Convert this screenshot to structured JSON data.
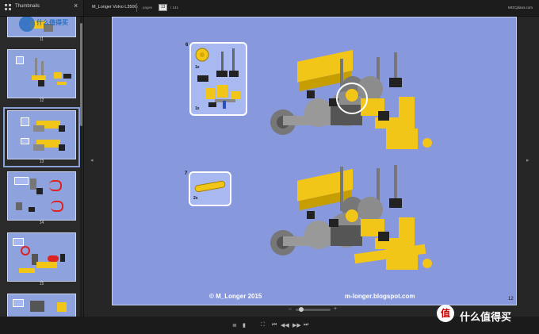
{
  "app": {
    "panel_title": "Thumbnails",
    "close_glyph": "×",
    "doc_title": "M_Longer Volvo L350G",
    "pages_label": "pages",
    "current_page": "13",
    "total_pages": "/ 141",
    "site": "MOCplans.com"
  },
  "sidebar": {
    "thumbnails": [
      {
        "label": "11"
      },
      {
        "label": "12"
      },
      {
        "label": "13",
        "selected": true
      },
      {
        "label": "14"
      },
      {
        "label": "15"
      }
    ],
    "watermark": "什么值得买"
  },
  "page": {
    "steps": [
      {
        "number": "6",
        "callout_quantities": [
          "1x",
          "1x"
        ]
      },
      {
        "number": "7",
        "callout_quantities": [
          "2x"
        ]
      }
    ],
    "footer_left": "© M_Longer 2015",
    "footer_right": "m-longer.blogspot.com",
    "page_number": "12"
  },
  "controls": {
    "nav_prev": "◂",
    "nav_next": "▸",
    "zoom_minus": "–",
    "zoom_plus": "+",
    "icons": [
      "list-icon",
      "bookmark-icon",
      "fullscreen-icon",
      "first-page-icon",
      "prev-page-icon",
      "next-page-icon",
      "last-page-icon"
    ],
    "glyphs": [
      "≣",
      "▮",
      "⛶",
      "⏮",
      "◀◀",
      "▶▶",
      "⏭"
    ]
  },
  "watermark": {
    "logo": "值",
    "text": "什么值得买"
  },
  "colors": {
    "page_bg": "#8798dc",
    "lego_yellow": "#f2c519",
    "lego_gray": "#8c8c8c",
    "callout_bg": "#a8b8f0"
  }
}
